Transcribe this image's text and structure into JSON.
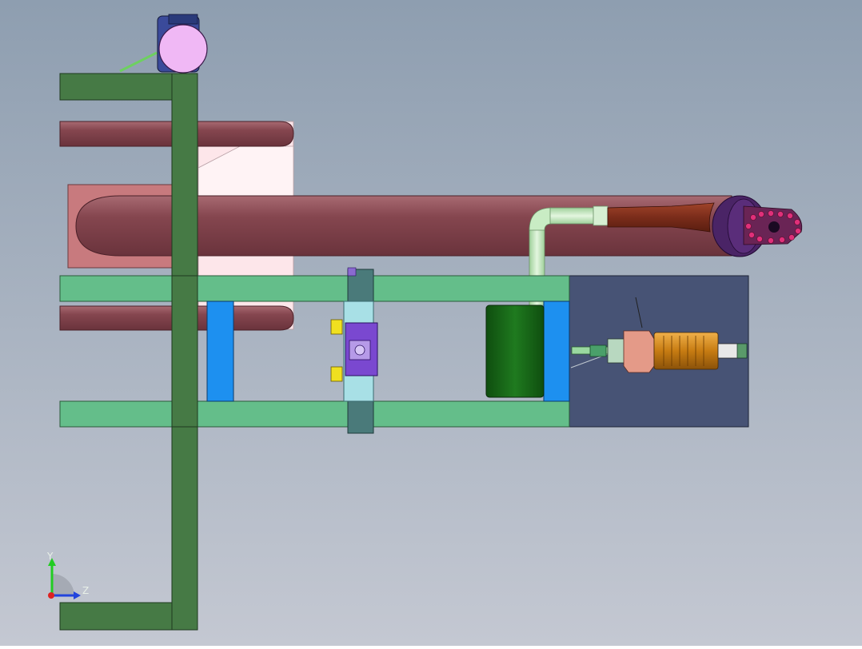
{
  "viewport": {
    "background_top": "#8e9eb0",
    "background_bottom": "#c4c8d2"
  },
  "triad": {
    "y_label": "Y",
    "z_label": "Z",
    "y_color": "#22cc22",
    "z_color": "#2244dd",
    "x_color": "#dd2222"
  },
  "colors": {
    "frame_dark_green": "#467a45",
    "frame_light_green": "#64be8a",
    "pipe_red": "#7f434d",
    "plate_pink": "#c87a7e",
    "plate_light": "#fde6ea",
    "blue_block": "#1d90f0",
    "drum_green": "#1d6a1d",
    "motor_panel": "#475375",
    "elbow_pipe": "#bde3b9",
    "motor_orange": "#d08a1a",
    "cutter_head": "#4a2466",
    "motor_top_pink": "#f0b8f5"
  }
}
